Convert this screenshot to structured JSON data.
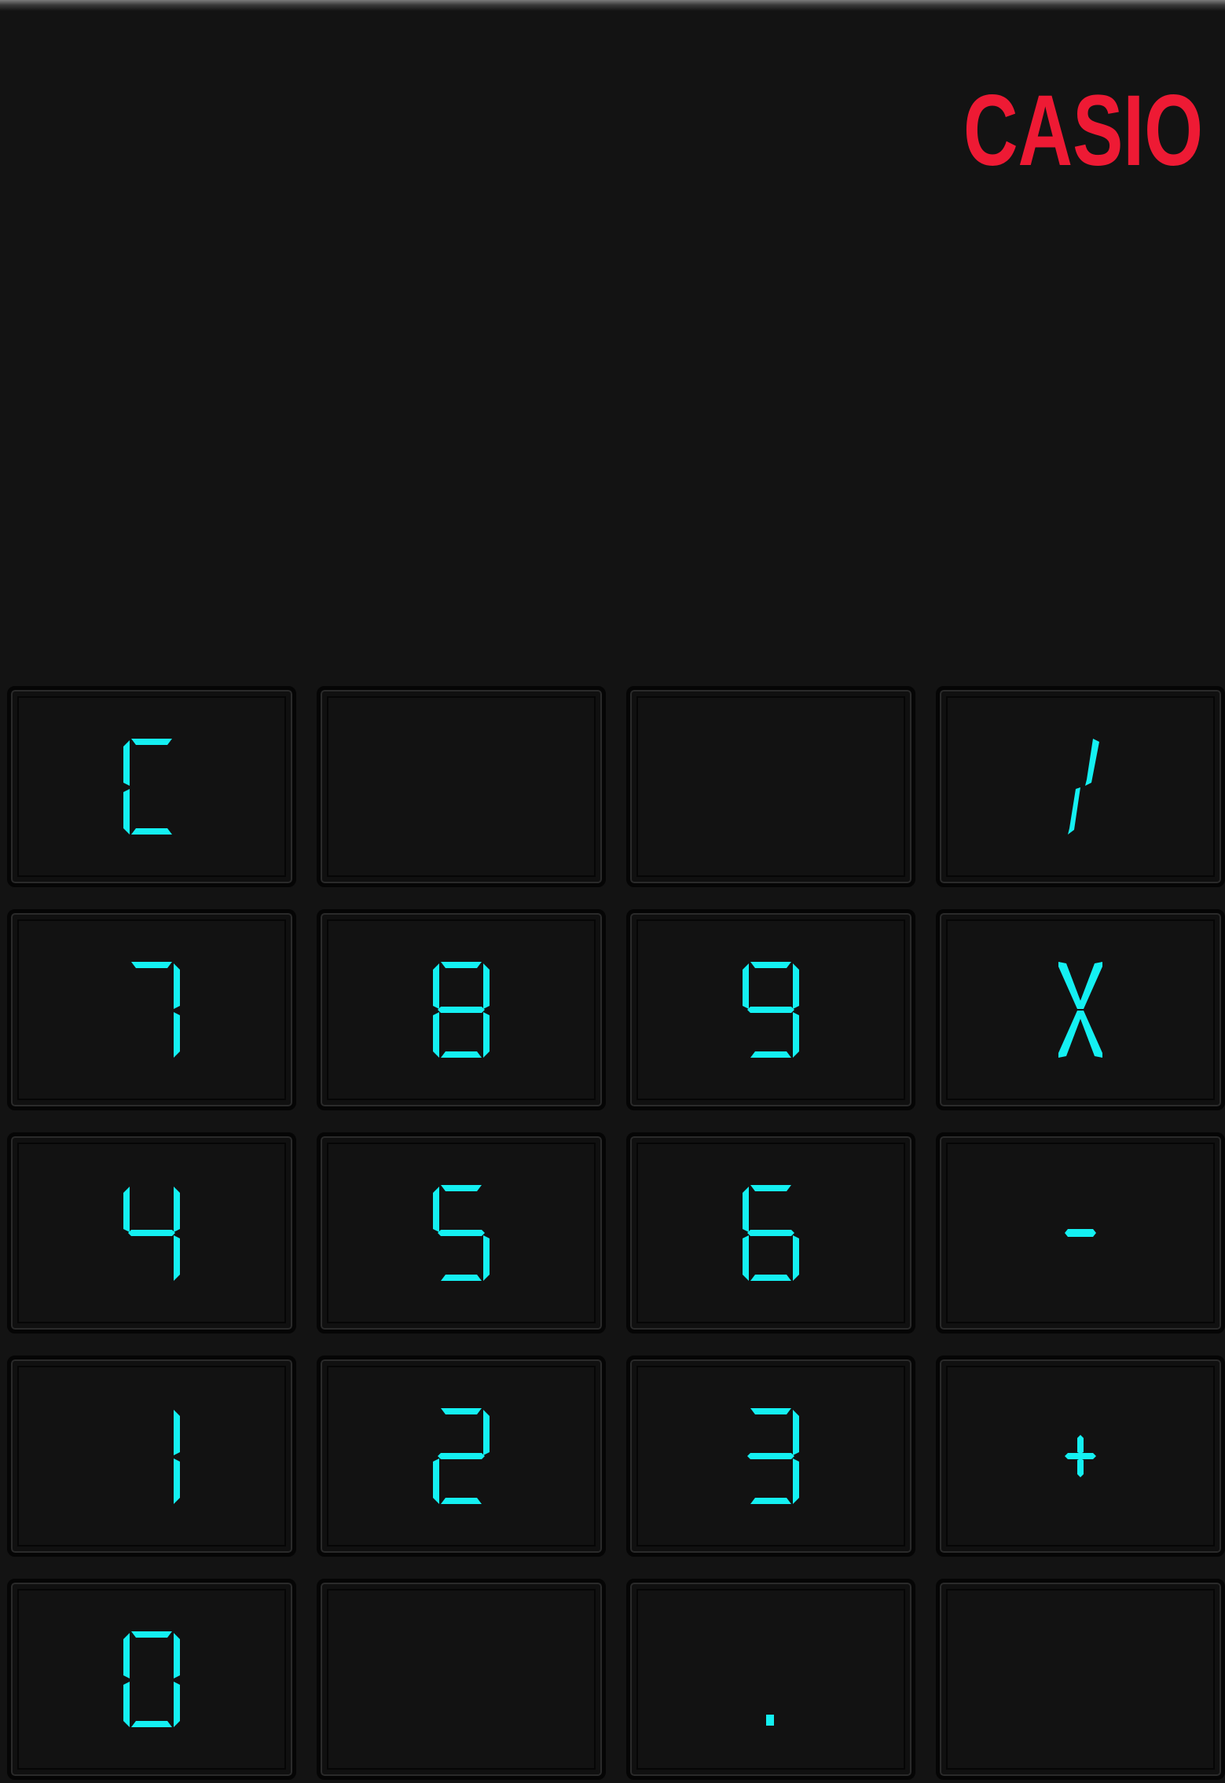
{
  "brand": {
    "name": "CASIO",
    "color": "#ee1a34"
  },
  "display": {
    "value": ""
  },
  "colors": {
    "background": "#131313",
    "key_face": "#121212",
    "key_border": "#050505",
    "segment": "#14f0f2"
  },
  "keypad": {
    "rows": [
      [
        {
          "label": "C",
          "name": "clear-button"
        },
        {
          "label": "",
          "name": "blank-button-1"
        },
        {
          "label": "",
          "name": "blank-button-2"
        },
        {
          "label": "/",
          "name": "divide-button"
        }
      ],
      [
        {
          "label": "7",
          "name": "digit-7-button"
        },
        {
          "label": "8",
          "name": "digit-8-button"
        },
        {
          "label": "9",
          "name": "digit-9-button"
        },
        {
          "label": "X",
          "name": "multiply-button"
        }
      ],
      [
        {
          "label": "4",
          "name": "digit-4-button"
        },
        {
          "label": "5",
          "name": "digit-5-button"
        },
        {
          "label": "6",
          "name": "digit-6-button"
        },
        {
          "label": "-",
          "name": "subtract-button"
        }
      ],
      [
        {
          "label": "1",
          "name": "digit-1-button"
        },
        {
          "label": "2",
          "name": "digit-2-button"
        },
        {
          "label": "3",
          "name": "digit-3-button"
        },
        {
          "label": "+",
          "name": "add-button"
        }
      ],
      [
        {
          "label": "0",
          "name": "digit-0-button"
        },
        {
          "label": "",
          "name": "blank-button-3"
        },
        {
          "label": ".",
          "name": "decimal-point-button"
        },
        {
          "label": "",
          "name": "blank-button-4"
        }
      ]
    ]
  }
}
